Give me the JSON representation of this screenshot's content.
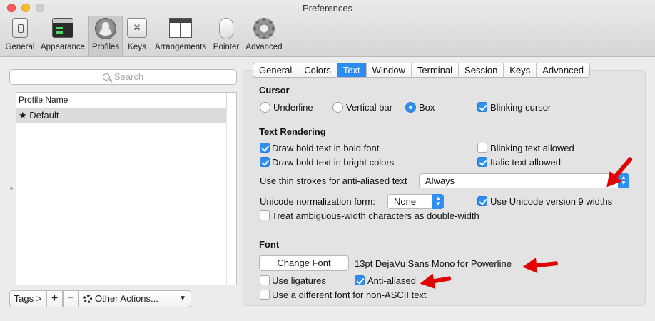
{
  "window": {
    "title": "Preferences"
  },
  "toolbar": {
    "items": [
      {
        "label": "General",
        "icon": "general-icon"
      },
      {
        "label": "Appearance",
        "icon": "appearance-icon"
      },
      {
        "label": "Profiles",
        "icon": "profiles-icon",
        "selected": true
      },
      {
        "label": "Keys",
        "icon": "keyboard-icon"
      },
      {
        "label": "Arrangements",
        "icon": "arrangements-icon"
      },
      {
        "label": "Pointer",
        "icon": "mouse-icon"
      },
      {
        "label": "Advanced",
        "icon": "gear-icon"
      }
    ]
  },
  "sidebar": {
    "search_placeholder": "Search",
    "column_header": "Profile Name",
    "profiles": [
      "★ Default"
    ],
    "tags_label": "Tags >",
    "add_label": "+",
    "remove_label": "−",
    "other_actions_label": "Other Actions..."
  },
  "tabs": [
    "General",
    "Colors",
    "Text",
    "Window",
    "Terminal",
    "Session",
    "Keys",
    "Advanced"
  ],
  "active_tab": "Text",
  "cursor": {
    "heading": "Cursor",
    "options": [
      "Underline",
      "Vertical bar",
      "Box"
    ],
    "selected": "Box",
    "blinking_label": "Blinking cursor",
    "blinking_checked": true
  },
  "text_rendering": {
    "heading": "Text Rendering",
    "bold_font": {
      "label": "Draw bold text in bold font",
      "checked": true
    },
    "bold_bright": {
      "label": "Draw bold text in bright colors",
      "checked": true
    },
    "blinking_text": {
      "label": "Blinking text allowed",
      "checked": false
    },
    "italic_text": {
      "label": "Italic text allowed",
      "checked": true
    },
    "thin_strokes_label": "Use thin strokes for anti-aliased text",
    "thin_strokes_value": "Always",
    "unicode_norm_label": "Unicode normalization form:",
    "unicode_norm_value": "None",
    "unicode9": {
      "label": "Use Unicode version 9 widths",
      "checked": true
    },
    "ambiguous": {
      "label": "Treat ambiguous-width characters as double-width",
      "checked": false
    }
  },
  "font": {
    "heading": "Font",
    "change_button": "Change Font",
    "current": "13pt DejaVu Sans Mono for Powerline",
    "ligatures": {
      "label": "Use ligatures",
      "checked": false
    },
    "anti_aliased": {
      "label": "Anti-aliased",
      "checked": true
    },
    "non_ascii": {
      "label": "Use a different font for non-ASCII text",
      "checked": false
    }
  },
  "colors": {
    "accent": "#2e8ff2",
    "annotation": "#e00000"
  }
}
